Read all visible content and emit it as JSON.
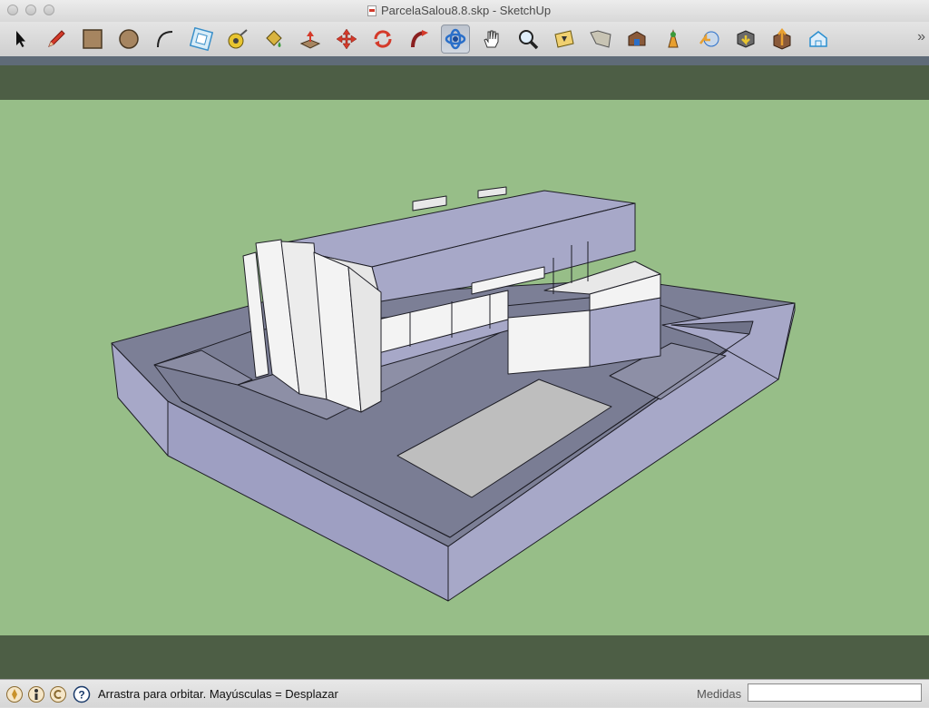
{
  "window": {
    "title": "ParcelaSalou8.8.skp - SketchUp"
  },
  "toolbar": {
    "tools": [
      {
        "name": "select-tool",
        "icon": "arrow-icon"
      },
      {
        "name": "pencil-tool",
        "icon": "pencil-icon"
      },
      {
        "name": "rectangle-tool",
        "icon": "rectangle-icon"
      },
      {
        "name": "circle-tool",
        "icon": "circle-icon"
      },
      {
        "name": "arc-tool",
        "icon": "arc-icon"
      },
      {
        "name": "offset-tool",
        "icon": "offset-icon"
      },
      {
        "name": "tape-measure-tool",
        "icon": "tape-measure-icon"
      },
      {
        "name": "paint-bucket-tool",
        "icon": "paint-bucket-icon"
      },
      {
        "name": "push-pull-tool",
        "icon": "push-pull-icon"
      },
      {
        "name": "move-tool",
        "icon": "move-icon"
      },
      {
        "name": "rotate-tool",
        "icon": "rotate-icon"
      },
      {
        "name": "follow-me-tool",
        "icon": "follow-me-icon"
      },
      {
        "name": "orbit-tool",
        "icon": "orbit-icon",
        "active": true
      },
      {
        "name": "pan-tool",
        "icon": "hand-icon"
      },
      {
        "name": "zoom-tool",
        "icon": "magnifier-icon"
      },
      {
        "name": "zoom-extents-tool",
        "icon": "zoom-extents-icon"
      },
      {
        "name": "add-location-tool",
        "icon": "map-icon"
      },
      {
        "name": "get-models-tool",
        "icon": "warehouse-icon"
      },
      {
        "name": "google-earth-tool",
        "icon": "earth-pin-icon"
      },
      {
        "name": "share-model-tool",
        "icon": "share-icon"
      },
      {
        "name": "get-components-tool",
        "icon": "components-icon"
      },
      {
        "name": "share-component-tool",
        "icon": "upload-icon"
      },
      {
        "name": "extension-tool",
        "icon": "extension-icon"
      },
      {
        "name": "preview-tool",
        "icon": "house-icon"
      }
    ],
    "overflow_label": "»"
  },
  "statusbar": {
    "message": "Arrastra para orbitar. Mayúsculas = Desplazar",
    "measure_label": "Medidas",
    "measure_value": ""
  },
  "colors": {
    "sky": "#4d5e45",
    "ground": "#97be88",
    "wall_face": "#a7a8c8",
    "floor_face": "#7c7f96",
    "white_face": "#f2f2f2"
  }
}
